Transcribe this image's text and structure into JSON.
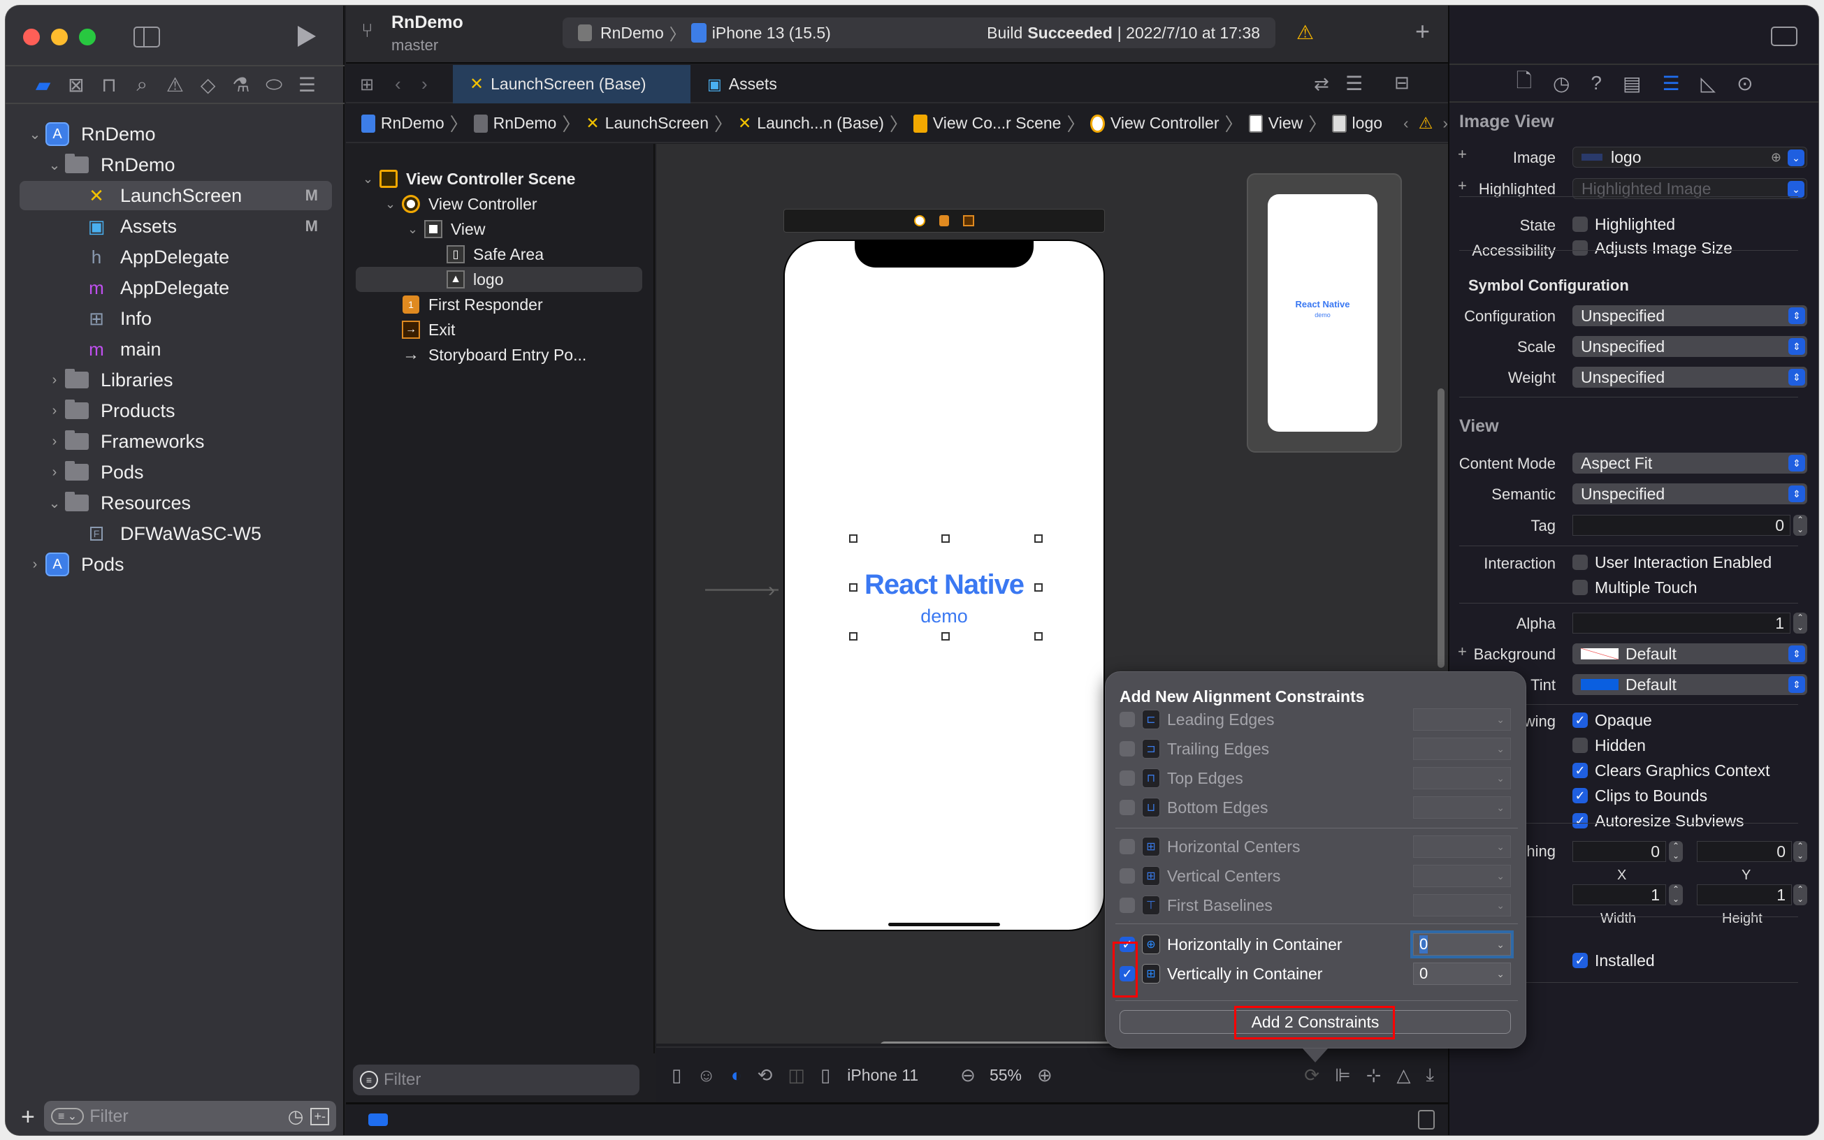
{
  "window": {
    "controls": {
      "close_color": "#ff5f57",
      "minimize_color": "#febc2e",
      "zoom_color": "#28c840"
    }
  },
  "toolbar": {
    "project_name": "RnDemo",
    "branch": "master",
    "scheme": "RnDemo",
    "device": "iPhone 13 (15.5)",
    "status_prefix": "Build",
    "status_bold": "Succeeded",
    "status_time": "| 2022/7/10 at 17:38",
    "warning_icon": "warning-triangle-icon",
    "add_icon": "plus-icon"
  },
  "navigator": {
    "tabs": [
      "folder-icon",
      "source-control-icon",
      "hierarchy-icon",
      "search-icon",
      "warning-icon",
      "test-icon",
      "debug-icon",
      "breakpoint-icon",
      "report-icon"
    ],
    "tree": [
      {
        "label": "RnDemo",
        "level": 0,
        "type": "project",
        "expanded": true
      },
      {
        "label": "RnDemo",
        "level": 1,
        "type": "folder",
        "expanded": true
      },
      {
        "label": "LaunchScreen",
        "level": 2,
        "type": "storyboard",
        "badge": "M",
        "selected": true
      },
      {
        "label": "Assets",
        "level": 2,
        "type": "assets",
        "badge": "M"
      },
      {
        "label": "AppDelegate",
        "level": 2,
        "type": "header"
      },
      {
        "label": "AppDelegate",
        "level": 2,
        "type": "objc"
      },
      {
        "label": "Info",
        "level": 2,
        "type": "plist"
      },
      {
        "label": "main",
        "level": 2,
        "type": "objc"
      },
      {
        "label": "Libraries",
        "level": 1,
        "type": "folder",
        "expanded": false
      },
      {
        "label": "Products",
        "level": 1,
        "type": "folder",
        "expanded": false
      },
      {
        "label": "Frameworks",
        "level": 1,
        "type": "folder",
        "expanded": false
      },
      {
        "label": "Pods",
        "level": 1,
        "type": "folder",
        "expanded": false
      },
      {
        "label": "Resources",
        "level": 1,
        "type": "folder",
        "expanded": true
      },
      {
        "label": "DFWaWaSC-W5",
        "level": 2,
        "type": "font"
      },
      {
        "label": "Pods",
        "level": 0,
        "type": "project",
        "expanded": false
      }
    ],
    "filter_placeholder": "Filter"
  },
  "tabs": [
    {
      "label": "LaunchScreen (Base)",
      "active": true
    },
    {
      "label": "Assets",
      "active": false
    }
  ],
  "jumpbar": [
    "RnDemo",
    "RnDemo",
    "LaunchScreen",
    "Launch...n (Base)",
    "View Co...r Scene",
    "View Controller",
    "View",
    "logo"
  ],
  "outline": {
    "items": [
      {
        "label": "View Controller Scene",
        "level": 0,
        "bold": true
      },
      {
        "label": "View Controller",
        "level": 1
      },
      {
        "label": "View",
        "level": 2
      },
      {
        "label": "Safe Area",
        "level": 3
      },
      {
        "label": "logo",
        "level": 3,
        "selected": true
      },
      {
        "label": "First Responder",
        "level": 1
      },
      {
        "label": "Exit",
        "level": 1
      },
      {
        "label": "Storyboard Entry Po...",
        "level": 1
      }
    ],
    "filter_placeholder": "Filter"
  },
  "canvas": {
    "logo_title": "React Native",
    "logo_subtitle": "demo",
    "logo_color": "#3a78f2"
  },
  "bottombar": {
    "device": "iPhone 11",
    "zoom": "55%"
  },
  "inspector": {
    "tabs": [
      "file-icon",
      "history-icon",
      "help-icon",
      "identity-icon",
      "attributes-icon",
      "size-icon",
      "connections-icon"
    ],
    "image_view": {
      "title": "Image View",
      "image_label": "Image",
      "image_value": "logo",
      "highlighted_label": "Highlighted",
      "highlighted_placeholder": "Highlighted Image",
      "state_label": "State",
      "state_option": "Highlighted",
      "state_checked": false,
      "accessibility_label": "Accessibility",
      "accessibility_option": "Adjusts Image Size",
      "accessibility_checked": false
    },
    "symbol": {
      "title": "Symbol Configuration",
      "configuration_label": "Configuration",
      "configuration_value": "Unspecified",
      "scale_label": "Scale",
      "scale_value": "Unspecified",
      "weight_label": "Weight",
      "weight_value": "Unspecified"
    },
    "view": {
      "title": "View",
      "content_mode_label": "Content Mode",
      "content_mode_value": "Aspect Fit",
      "semantic_label": "Semantic",
      "semantic_value": "Unspecified",
      "tag_label": "Tag",
      "tag_value": "0",
      "interaction_label": "Interaction",
      "user_interaction": "User Interaction Enabled",
      "multiple_touch": "Multiple Touch",
      "alpha_label": "Alpha",
      "alpha_value": "1",
      "background_label": "Background",
      "background_value": "Default",
      "tint_label": "Tint",
      "tint_value": "Default",
      "tint_color": "#0a5fe0",
      "drawing_label": "Drawing",
      "opaque": "Opaque",
      "hidden": "Hidden",
      "clears": "Clears Graphics Context",
      "clips": "Clips to Bounds",
      "autoresize": "Autoresize Subviews",
      "stretching_label": "Stretching",
      "x_value": "0",
      "x_label": "X",
      "y_value": "0",
      "y_label": "Y",
      "width_value": "1",
      "width_label": "Width",
      "height_value": "1",
      "height_label": "Height",
      "installed": "Installed"
    }
  },
  "popover": {
    "title": "Add New Alignment Constraints",
    "rows": [
      {
        "label": "Leading Edges",
        "checked": false,
        "value": ""
      },
      {
        "label": "Trailing Edges",
        "checked": false,
        "value": ""
      },
      {
        "label": "Top Edges",
        "checked": false,
        "value": ""
      },
      {
        "label": "Bottom Edges",
        "checked": false,
        "value": ""
      },
      {
        "label": "Horizontal Centers",
        "checked": false,
        "value": ""
      },
      {
        "label": "Vertical Centers",
        "checked": false,
        "value": ""
      },
      {
        "label": "First Baselines",
        "checked": false,
        "value": ""
      },
      {
        "label": "Horizontally in Container",
        "checked": true,
        "value": "0"
      },
      {
        "label": "Vertically in Container",
        "checked": true,
        "value": "0"
      }
    ],
    "add_button": "Add 2 Constraints"
  }
}
